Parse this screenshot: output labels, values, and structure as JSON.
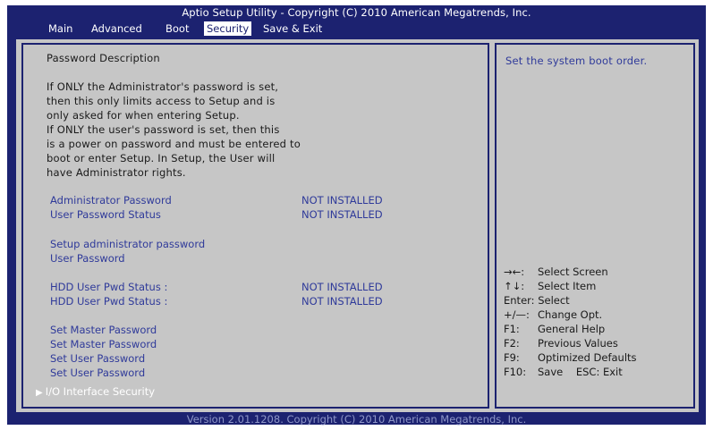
{
  "title": "Aptio Setup Utility - Copyright (C) 2010 American Megatrends, Inc.",
  "menu": [
    {
      "label": "Main",
      "active": false
    },
    {
      "label": "Advanced",
      "active": false
    },
    {
      "label": "Boot",
      "active": false
    },
    {
      "label": "Security",
      "active": true
    },
    {
      "label": "Save & Exit",
      "active": false
    }
  ],
  "description": {
    "heading": "Password Description",
    "lines": [
      "If ONLY the Administrator's password is set,",
      "then this only limits access to Setup and is",
      "only asked for when entering Setup.",
      "If ONLY the user's password is set, then this",
      "is a power on password and must be entered to",
      "boot or enter Setup. In Setup, the User will",
      "have Administrator rights."
    ]
  },
  "status_rows": [
    {
      "label": "Administrator Password",
      "value": "NOT INSTALLED"
    },
    {
      "label": "User Password Status",
      "value": "NOT INSTALLED"
    }
  ],
  "setup_items": [
    "Setup administrator password",
    "User Password"
  ],
  "hdd_rows": [
    {
      "label": "HDD User Pwd Status :",
      "value": "NOT INSTALLED"
    },
    {
      "label": "HDD User Pwd Status :",
      "value": "NOT INSTALLED"
    }
  ],
  "password_items": [
    "Set Master Password",
    "Set Master Password",
    "Set User Password",
    "Set User Password"
  ],
  "submenu": {
    "label": "I/O Interface Security",
    "icon": "triangle-right-icon"
  },
  "help_text": "Set the system boot order.",
  "keys": [
    {
      "key": "→←:",
      "action": "Select Screen"
    },
    {
      "key": "↑↓:",
      "action": "Select Item"
    },
    {
      "key": "Enter:",
      "action": "Select"
    },
    {
      "key": "+/—:",
      "action": "Change Opt."
    },
    {
      "key": "F1:",
      "action": "General Help"
    },
    {
      "key": "F2:",
      "action": "Previous Values"
    },
    {
      "key": "F9:",
      "action": "Optimized Defaults"
    },
    {
      "key": "F10:",
      "action": "Save    ESC: Exit"
    }
  ],
  "footer": "Version 2.01.1208. Copyright (C) 2010 American Megatrends, Inc.",
  "colors": {
    "background": "#1c2270",
    "panel": "#c6c6c6",
    "item_text": "#2f3a9a"
  }
}
